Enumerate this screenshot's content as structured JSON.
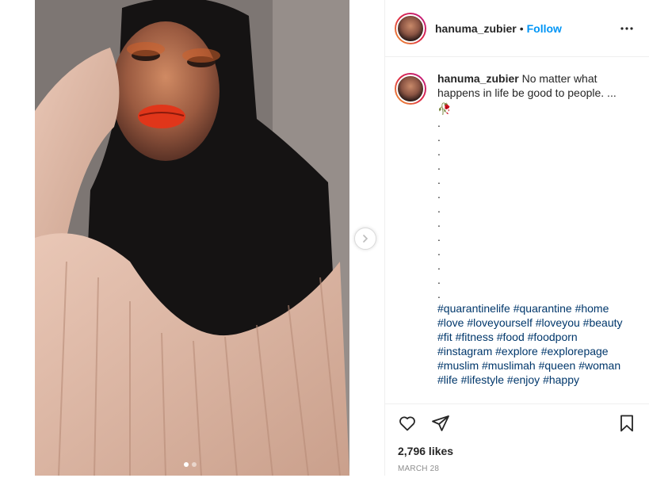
{
  "post": {
    "username": "hanuma_zubier",
    "separator": "•",
    "follow_label": "Follow",
    "more_icon": "more-options-icon",
    "next_icon": "chevron-right-icon"
  },
  "caption": {
    "username": "hanuma_zubier",
    "text": "No matter what happens in life be good to people. ...",
    "emoji": "🥀",
    "dot_lines": [
      ".",
      ".",
      ".",
      ".",
      ".",
      ".",
      ".",
      ".",
      ".",
      ".",
      ".",
      ".",
      "."
    ],
    "hashtag_lines": [
      "#quarantinelife #quarantine #home",
      "#love #loveyourself #loveyou #beauty",
      "#fit #fitness #food #foodporn",
      "#instagram #explore #explorepage",
      "#muslim #muslimah #queen #woman",
      "#life #lifestyle #enjoy #happy"
    ]
  },
  "actions": {
    "like_icon": "heart-icon",
    "share_icon": "paper-plane-icon",
    "save_icon": "bookmark-icon"
  },
  "likes": "2,796 likes",
  "date": "MARCH 28",
  "colors": {
    "follow": "#0095f6",
    "hashtag": "#00376b",
    "text": "#262626",
    "muted": "#8e8e8e"
  }
}
